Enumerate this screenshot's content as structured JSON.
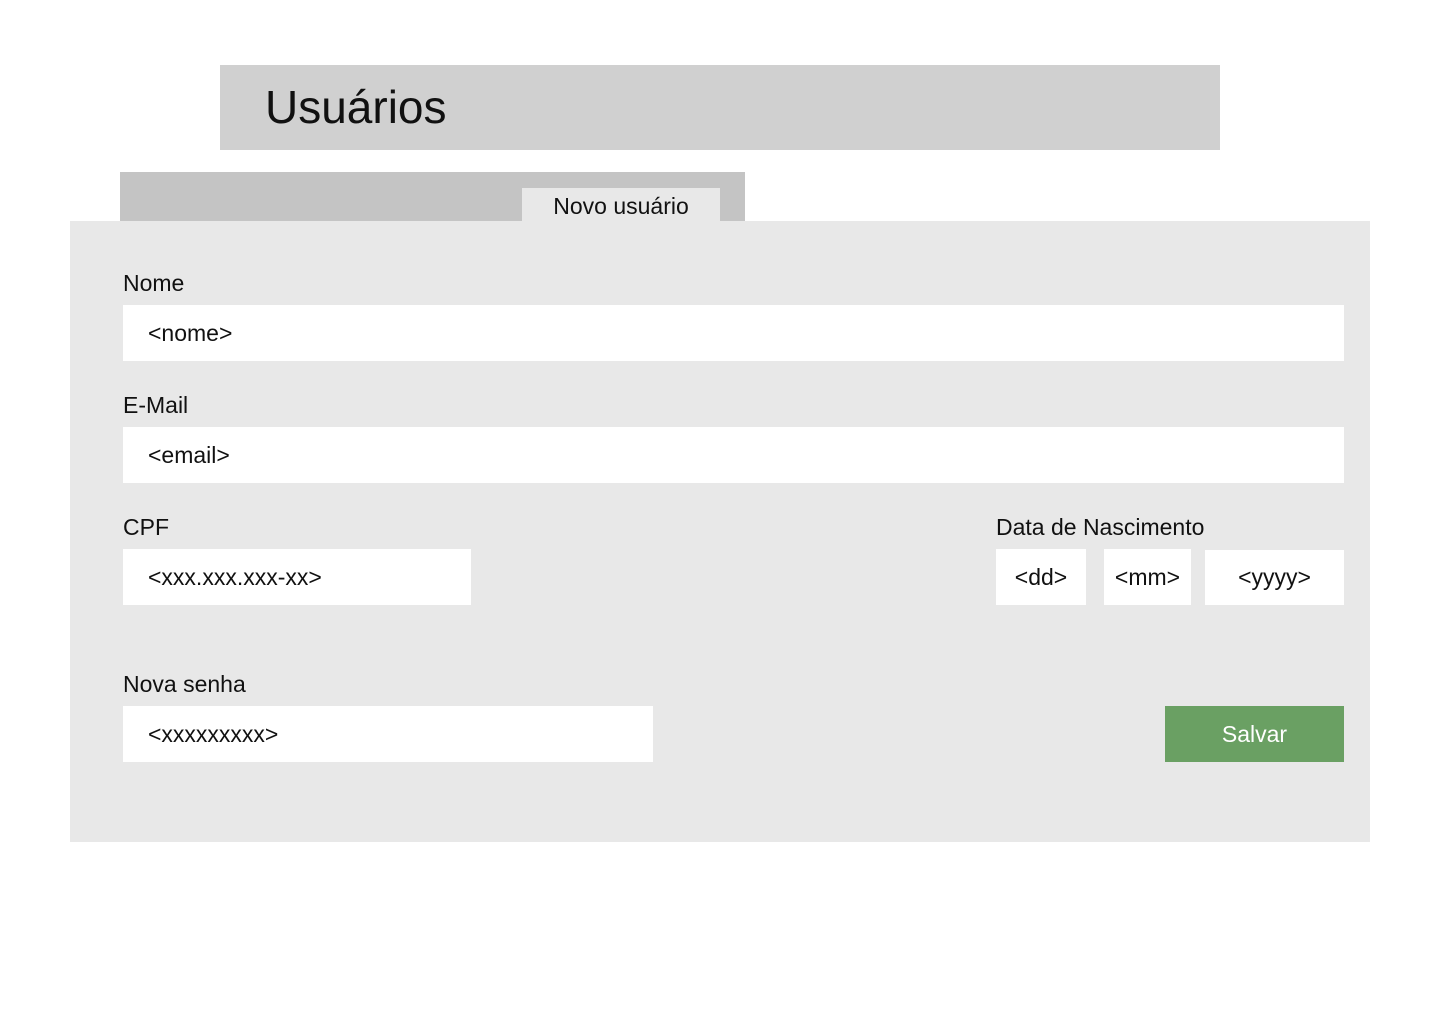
{
  "header": {
    "title": "Usuários"
  },
  "tabs": [
    {
      "label": "Novo usuário",
      "active": true
    }
  ],
  "form": {
    "nome": {
      "label": "Nome",
      "placeholder": "<nome>",
      "value": ""
    },
    "email": {
      "label": "E-Mail",
      "placeholder": "<email>",
      "value": ""
    },
    "cpf": {
      "label": "CPF",
      "placeholder": "<xxx.xxx.xxx-xx>",
      "value": ""
    },
    "birth_date": {
      "label": "Data de Nascimento",
      "day_placeholder": "<dd>",
      "month_placeholder": "<mm>",
      "year_placeholder": "<yyyy>"
    },
    "password": {
      "label": "Nova senha",
      "placeholder": "<xxxxxxxxx>",
      "value": ""
    },
    "save_label": "Salvar"
  },
  "colors": {
    "header_bg": "#d0d0d0",
    "tab_strip_bg": "#c4c4c4",
    "panel_bg": "#e8e8e8",
    "field_bg": "#ffffff",
    "save_button_bg": "#6aa063",
    "save_button_text": "#ffffff"
  }
}
